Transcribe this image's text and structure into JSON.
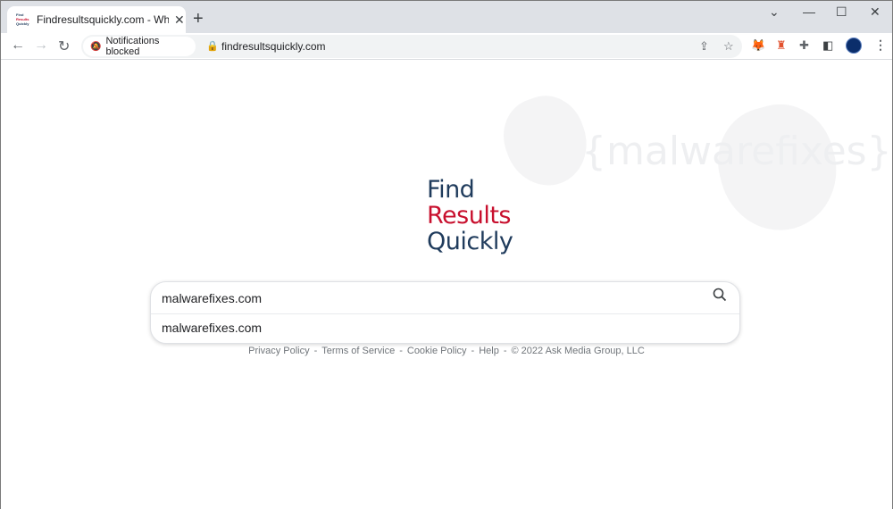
{
  "browser": {
    "tab": {
      "favicon_lines": [
        "Find",
        "Results",
        "Quickly"
      ],
      "title": "Findresultsquickly.com - What's Y",
      "close_glyph": "✕"
    },
    "new_tab_glyph": "+",
    "window_controls": {
      "tab_search": "⌄",
      "minimize": "—",
      "maximize": "☐",
      "close": "✕"
    },
    "nav": {
      "back": "←",
      "forward": "→",
      "reload": "↻"
    },
    "omnibox": {
      "chip_label": "Notifications blocked",
      "chip_icon": "bell-off-icon",
      "lock_icon": "lock-icon",
      "url": "findresultsquickly.com",
      "share_glyph": "⇪",
      "bookmark_glyph": "☆"
    },
    "extensions": {
      "metamask": "🦊",
      "ext2": "♜",
      "puzzle": "✚",
      "sidepanel": "◧"
    },
    "menu_glyph": "⋮"
  },
  "page": {
    "logo": {
      "line1": "Find",
      "line2": "Results",
      "line3": "Quickly"
    },
    "watermark": "{malwarefixes}",
    "search": {
      "value": "malwarefixes.com",
      "placeholder": "",
      "search_glyph": "⚲",
      "suggestions": [
        "malwarefixes.com"
      ]
    },
    "footer": {
      "links": [
        "Privacy Policy",
        "Terms of Service",
        "Cookie Policy",
        "Help"
      ],
      "copyright": "© 2022 Ask Media Group, LLC",
      "separator": "-"
    }
  }
}
